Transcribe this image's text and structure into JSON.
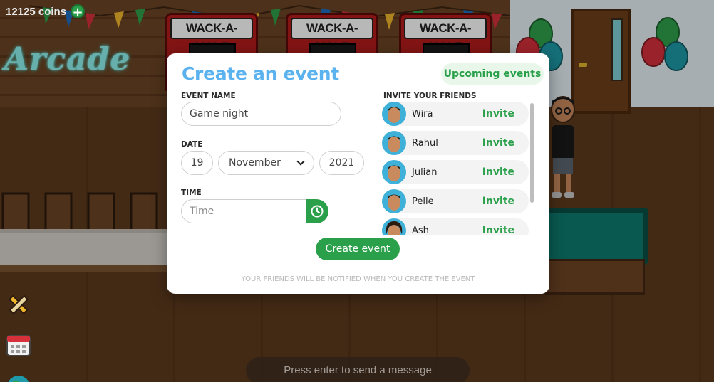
{
  "hud": {
    "coins_text": "12125 coins",
    "add_coins_symbol": "+"
  },
  "scene": {
    "arcade_sign_text": "Arcade",
    "machine_labels": [
      "WACK-A-MOLE",
      "WACK-A-MOLE",
      "WACK-A-MOLE"
    ]
  },
  "chat": {
    "placeholder": "Press enter to send a message"
  },
  "modal": {
    "title": "Create an event",
    "upcoming_label": "Upcoming events",
    "event_name": {
      "label": "EVENT NAME",
      "value": "Game night"
    },
    "date": {
      "label": "DATE",
      "day": "19",
      "month": "November",
      "year": "2021"
    },
    "time": {
      "label": "TIME",
      "placeholder": "Time"
    },
    "friends": {
      "label": "INVITE YOUR FRIENDS",
      "items": [
        {
          "name": "Wira",
          "action": "Invite"
        },
        {
          "name": "Rahul",
          "action": "Invite"
        },
        {
          "name": "Julian",
          "action": "Invite"
        },
        {
          "name": "Pelle",
          "action": "Invite"
        },
        {
          "name": "Ash",
          "action": "Invite"
        }
      ]
    },
    "create_label": "Create event",
    "footnote": "YOUR FRIENDS WILL BE NOTIFIED WHEN YOU CREATE THE EVENT"
  },
  "colors": {
    "accent_green": "#2aa04a",
    "title_blue": "#5ab2ef"
  },
  "icons": [
    "plus-icon",
    "clock-icon",
    "chevron-down-icon",
    "pencil-icon",
    "calendar-icon",
    "globe-icon"
  ]
}
